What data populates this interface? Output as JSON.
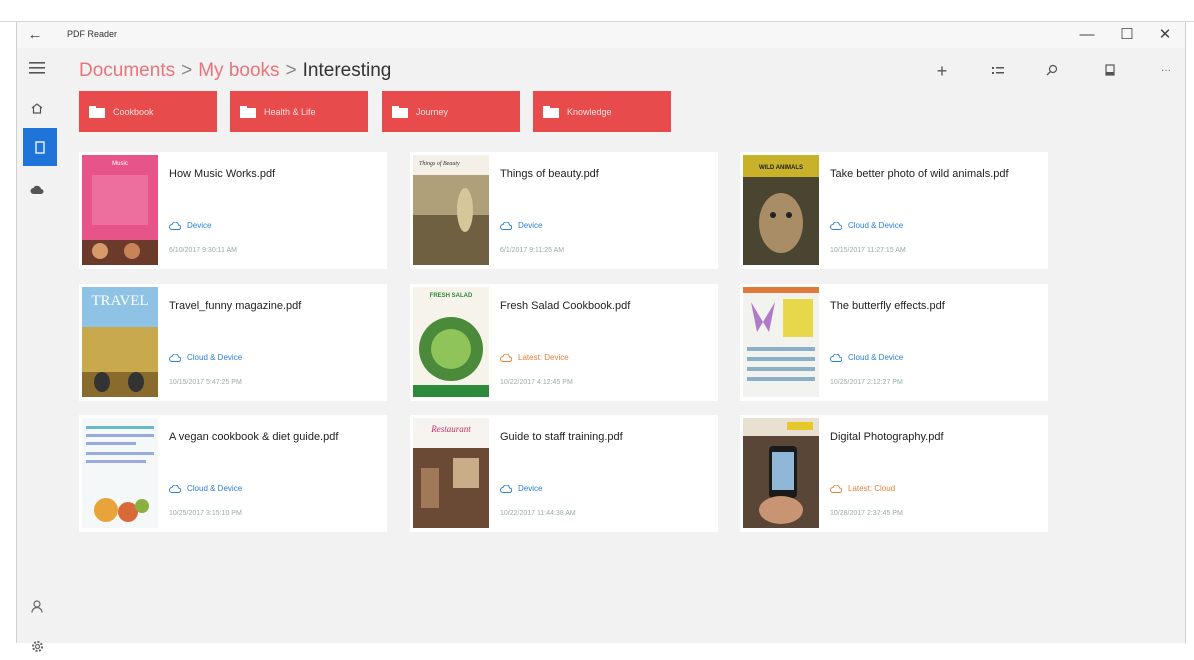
{
  "window": {
    "title": "PDF Reader",
    "back_glyph": "←",
    "minimize_glyph": "—",
    "maximize_glyph": "☐",
    "close_glyph": "✕"
  },
  "breadcrumb": {
    "items": [
      "Documents",
      "My books"
    ],
    "separator": ">",
    "current": "Interesting"
  },
  "toolbar": {
    "add_glyph": "+",
    "more_glyph": "···"
  },
  "folders": [
    {
      "label": "Cookbook"
    },
    {
      "label": "Health & Life"
    },
    {
      "label": "Journey"
    },
    {
      "label": "Knowledge"
    }
  ],
  "books": [
    {
      "title": "How Music Works.pdf",
      "location": "Device",
      "date": "6/10/2017 9:30:11 AM",
      "location_color": "#2a7fd4"
    },
    {
      "title": "Things of beauty.pdf",
      "location": "Device",
      "date": "6/1/2017 9:11:25 AM",
      "location_color": "#2a7fd4"
    },
    {
      "title": "Take better photo of wild animals.pdf",
      "location": "Cloud & Device",
      "date": "10/15/2017 11:27:15 AM",
      "location_color": "#2a7fd4"
    },
    {
      "title": "Travel_funny magazine.pdf",
      "location": "Cloud & Device",
      "date": "10/15/2017 5:47:25 PM",
      "location_color": "#2a7fd4"
    },
    {
      "title": "Fresh Salad Cookbook.pdf",
      "location": "Latest: Device",
      "date": "10/22/2017 4:12:45 PM",
      "location_color": "#e0833a"
    },
    {
      "title": "The butterfly effects.pdf",
      "location": "Cloud & Device",
      "date": "10/25/2017 2:12:27 PM",
      "location_color": "#2a7fd4"
    },
    {
      "title": "A vegan cookbook & diet guide.pdf",
      "location": "Cloud & Device",
      "date": "10/25/2017 3:15:10 PM",
      "location_color": "#2a7fd4"
    },
    {
      "title": "Guide to staff training.pdf",
      "location": "Device",
      "date": "10/22/2017 11:44:38 AM",
      "location_color": "#2a7fd4"
    },
    {
      "title": "Digital Photography.pdf",
      "location": "Latest: Cloud",
      "date": "10/28/2017 2:37:45 PM",
      "location_color": "#e0833a"
    }
  ],
  "thumbs": {
    "music": "Music",
    "beauty": "Things of Beauty",
    "wild": "WILD ANIMALS",
    "travel": "TRAVEL",
    "salad": "FRESH SALAD",
    "restaurant": "Restaurant"
  },
  "colors": {
    "accent_red": "#e84b4b",
    "breadcrumb_link": "#e8747b",
    "active_blue": "#1e74d8",
    "cloud_blue": "#2a7fd4",
    "latest_orange": "#e0833a"
  }
}
